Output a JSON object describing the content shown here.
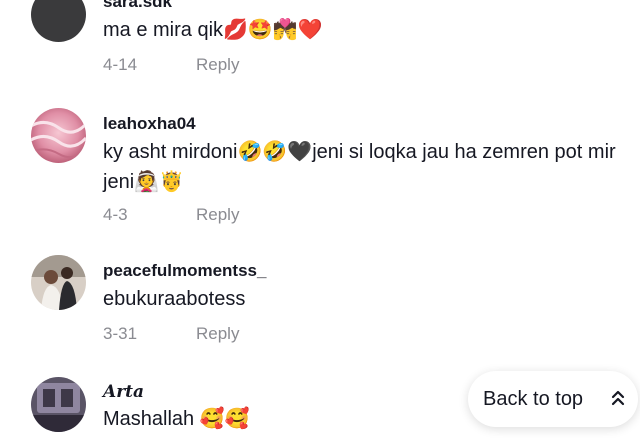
{
  "comments": [
    {
      "username": "sara.sdk",
      "text": "ma e mira qik💋🤩💏❤️",
      "date": "4-14",
      "reply": "Reply"
    },
    {
      "username": "leahoxha04",
      "text": "ky asht mirdoni🤣🤣🖤jeni si loqka jau ha zemren pot mir jeni👰🤴",
      "date": "4-3",
      "reply": "Reply"
    },
    {
      "username": "peacefulmomentss_",
      "text": "ebukuraabotess",
      "date": "3-31",
      "reply": "Reply"
    },
    {
      "username": "𝑨𝒓𝒕𝒂",
      "text": "Mashallah 🥰🥰"
    }
  ],
  "back_to_top": {
    "label": "Back to top",
    "icon": "double-chevron-up-icon"
  }
}
